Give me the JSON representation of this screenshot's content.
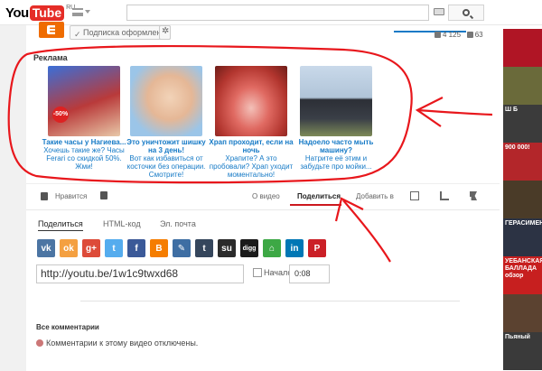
{
  "header": {
    "logo_you": "You",
    "logo_tube": "Tube",
    "logo_region": "RU",
    "search_placeholder": ""
  },
  "channel": {
    "subscribe_label": "Подписка оформлена",
    "likes": "4 125",
    "dislikes": "63"
  },
  "ads": {
    "label": "Реклама",
    "items": [
      {
        "title": "Такие часы у Нагиева...",
        "text": "Хочешь такие же? Часы Ferari со скидкой 50%. Жми!",
        "badge": "-50%",
        "image": "watch-man-photo"
      },
      {
        "title": "Это уничтожит шишку на 3 день!",
        "text": "Вот как избавиться от косточки без операции. Смотрите!",
        "image": "foot-bunion-photo"
      },
      {
        "title": "Храп проходит, если на ночь",
        "text": "Храпите? А это пробовали? Храп уходит моментально!",
        "image": "throat-photo"
      },
      {
        "title": "Надоело часто мыть машину?",
        "text": "Натрите её этим и забудьте про мойки...",
        "image": "car-photo"
      }
    ]
  },
  "actions": {
    "like": "Нравится",
    "about": "О видео",
    "share": "Поделиться",
    "add_to": "Добавить в"
  },
  "share": {
    "tabs": [
      "Поделиться",
      "HTML-код",
      "Эл. почта"
    ],
    "url": "http://youtu.be/1w1c9twxd68",
    "start_label": "Начало:",
    "start_time": "0:08",
    "social": [
      {
        "name": "vk",
        "glyph": "vk",
        "color": "#4c75a3"
      },
      {
        "name": "odnoklassniki",
        "glyph": "ok",
        "color": "#f4a041"
      },
      {
        "name": "google-plus",
        "glyph": "g+",
        "color": "#dd4b39"
      },
      {
        "name": "twitter",
        "glyph": "t",
        "color": "#55acee"
      },
      {
        "name": "facebook",
        "glyph": "f",
        "color": "#3b5998"
      },
      {
        "name": "blogger",
        "glyph": "B",
        "color": "#f57d00"
      },
      {
        "name": "livejournal",
        "glyph": "✎",
        "color": "#3e6ea3"
      },
      {
        "name": "tumblr",
        "glyph": "t",
        "color": "#35465c"
      },
      {
        "name": "stumbleupon",
        "glyph": "su",
        "color": "#2b2b2b"
      },
      {
        "name": "digg",
        "glyph": "digg",
        "color": "#1b1b1b"
      },
      {
        "name": "myspace",
        "glyph": "⌂",
        "color": "#3da845"
      },
      {
        "name": "linkedin",
        "glyph": "in",
        "color": "#0077b5"
      },
      {
        "name": "pinterest",
        "glyph": "P",
        "color": "#cb2027"
      }
    ]
  },
  "comments": {
    "title": "Все комментарии",
    "disabled_text": "Комментарии к этому видео отключены."
  },
  "sidebar": {
    "thumbs": [
      {
        "caption": "",
        "bg": "#b01525"
      },
      {
        "caption": "",
        "bg": "#6a6a3a"
      },
      {
        "caption": "Ш Б",
        "bg": "#3b3b3b"
      },
      {
        "caption": "900 000!",
        "bg": "#b3262a"
      },
      {
        "caption": "",
        "bg": "#4a3b28"
      },
      {
        "caption": "ГЕРАСИМЕНКО",
        "bg": "#2c3344"
      },
      {
        "caption": "УЕБАНСКАЯ БАЛЛАДА обзор",
        "bg": "#c71f1f"
      },
      {
        "caption": "",
        "bg": "#5b4230"
      },
      {
        "caption": "Пьяный",
        "bg": "#3a3a3a"
      }
    ]
  },
  "colors": {
    "accent": "#cc181e",
    "link": "#167ac6",
    "annotation": "#e8171c"
  }
}
